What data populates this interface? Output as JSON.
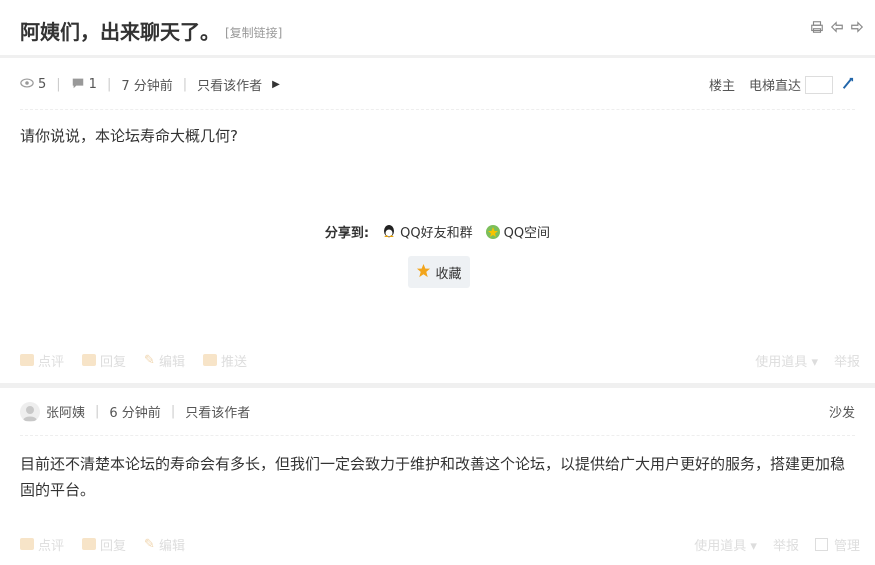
{
  "thread": {
    "title": "阿姨们，出来聊天了。",
    "copy_link": "[复制链接]"
  },
  "icons": {
    "print": "print-icon",
    "prev": "arrow-left-icon",
    "next": "arrow-right-icon"
  },
  "post1": {
    "views": "5",
    "replies": "1",
    "time": "7 分钟前",
    "only_author": "只看该作者",
    "floor": "楼主",
    "jump_label": "电梯直达",
    "body": "请你说说，本论坛寿命大概几何?",
    "share_label": "分享到:",
    "share_qq": "QQ好友和群",
    "share_qzone": "QQ空间",
    "favorite": "收藏",
    "actions": [
      "点评",
      "回复",
      "编辑",
      "推送"
    ],
    "tools": "使用道具",
    "report": "举报"
  },
  "post2": {
    "author": "张阿姨",
    "time": "6 分钟前",
    "only_author": "只看该作者",
    "floor": "沙发",
    "body": "目前还不清楚本论坛的寿命会有多长，但我们一定会致力于维护和改善这个论坛，以提供给广大用户更好的服务，搭建更加稳固的平台。",
    "actions": [
      "点评",
      "回复",
      "编辑"
    ],
    "tools": "使用道具",
    "report": "举报",
    "manage": "管理"
  }
}
